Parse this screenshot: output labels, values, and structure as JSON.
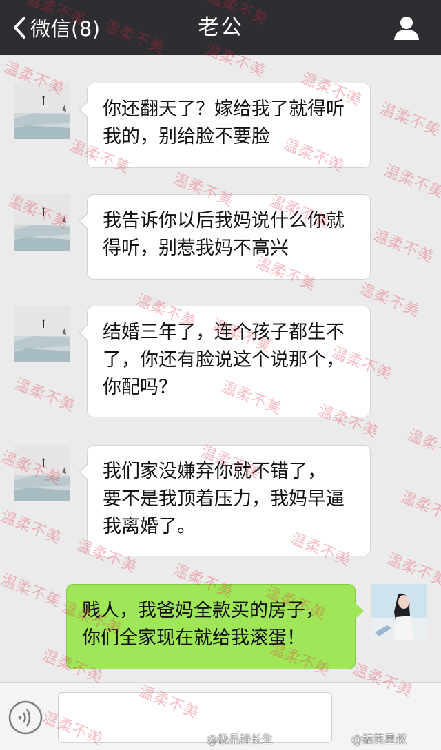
{
  "header": {
    "back_label": "微信(8)",
    "title": "老公",
    "profile_icon": "person-icon"
  },
  "messages": [
    {
      "sender": "contact",
      "text_lines": [
        "你还翻天了？嫁给我了就得听",
        "我的，别给脸不要脸"
      ]
    },
    {
      "sender": "contact",
      "text_lines": [
        "我告诉你以后我妈说什么你就",
        "得听，别惹我妈不高兴"
      ]
    },
    {
      "sender": "contact",
      "text_lines": [
        "结婚三年了，连个孩子都生不",
        "了，你还有脸说这个说那个，",
        "你配吗？"
      ]
    },
    {
      "sender": "contact",
      "text_lines": [
        "我们家没嫌弃你就不错了，",
        "要不是我顶着压力，我妈早逼",
        "我离婚了。"
      ]
    },
    {
      "sender": "me",
      "text_lines": [
        "贱人，我爸妈全款买的房子，",
        "你们全家现在就给我滚蛋！"
      ]
    }
  ],
  "input_bar": {
    "voice_icon": "voice-icon",
    "text_value": ""
  },
  "watermark_text": "温柔不美",
  "credits": [
    "@极品特长生",
    "@搞笑星叔"
  ],
  "colors": {
    "header_bg": "#2e2d32",
    "chat_bg": "#ebebeb",
    "sent_bubble": "#9fe658",
    "received_bubble": "#ffffff",
    "watermark": "#e6283c"
  }
}
